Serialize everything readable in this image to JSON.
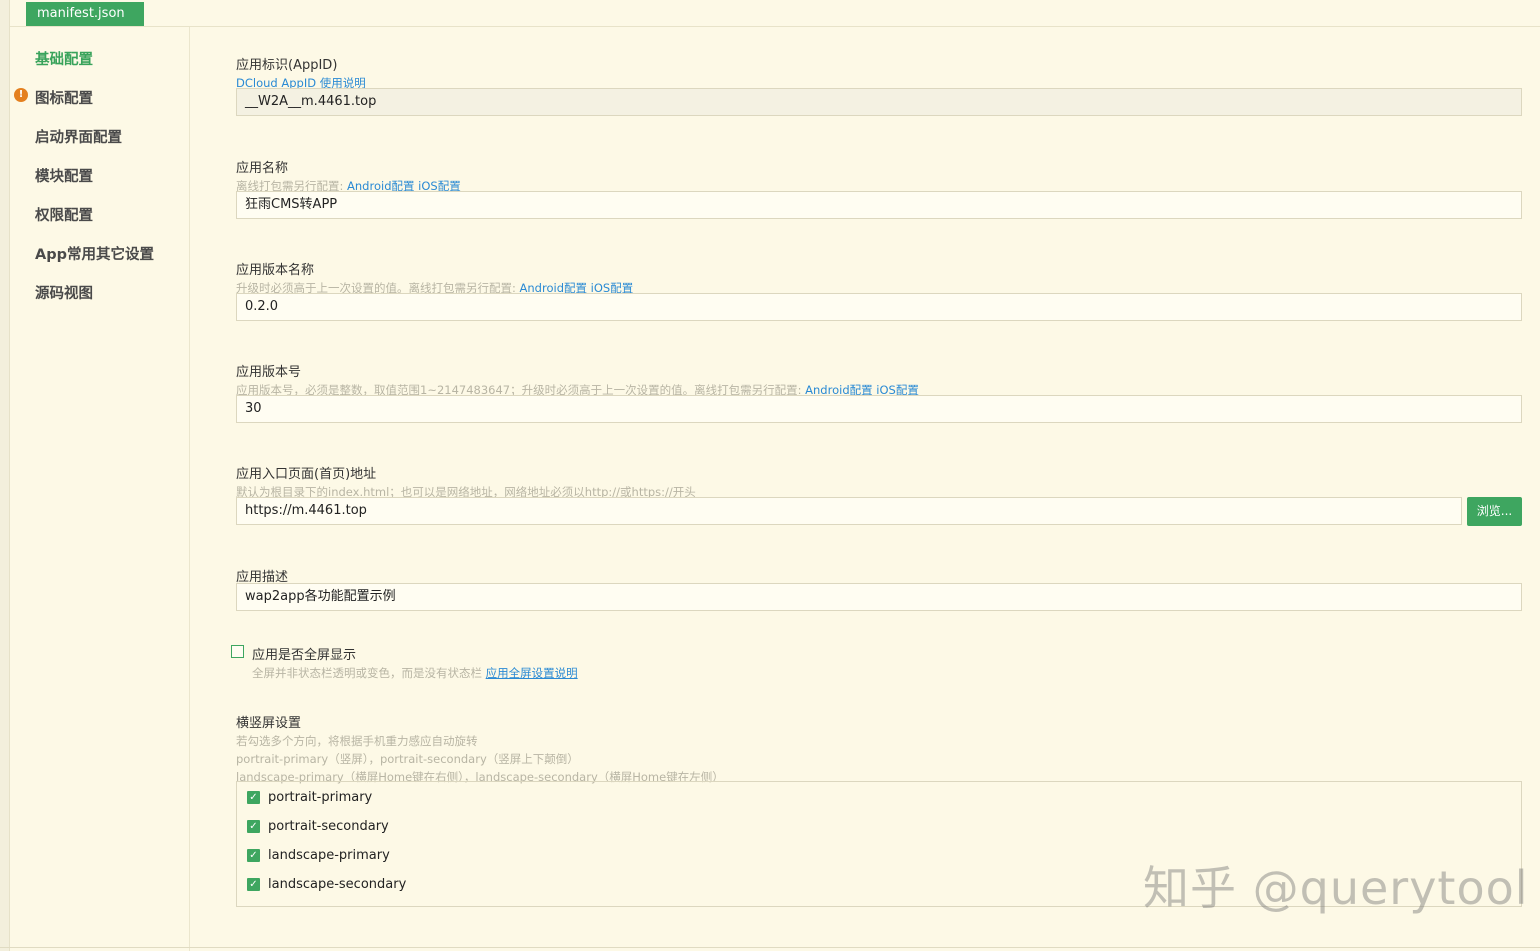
{
  "tab": {
    "label": "manifest.json"
  },
  "sidebar": {
    "items": [
      {
        "label": "基础配置"
      },
      {
        "label": "图标配置"
      },
      {
        "label": "启动界面配置"
      },
      {
        "label": "模块配置"
      },
      {
        "label": "权限配置"
      },
      {
        "label": "App常用其它设置"
      },
      {
        "label": "源码视图"
      }
    ]
  },
  "appid": {
    "label": "应用标识(AppID)",
    "link": "DCloud AppID 使用说明",
    "value": "__W2A__m.4461.top"
  },
  "name": {
    "label": "应用名称",
    "hint": "离线打包需另行配置:",
    "android": "Android配置",
    "ios": "iOS配置",
    "value": "狂雨CMS转APP"
  },
  "version_name": {
    "label": "应用版本名称",
    "hint": "升级时必须高于上一次设置的值。离线打包需另行配置:",
    "android": "Android配置",
    "ios": "iOS配置",
    "value": "0.2.0"
  },
  "version_code": {
    "label": "应用版本号",
    "hint": "应用版本号，必须是整数，取值范围1~2147483647；升级时必须高于上一次设置的值。离线打包需另行配置:",
    "android": "Android配置",
    "ios": "iOS配置",
    "value": "30"
  },
  "entry": {
    "label": "应用入口页面(首页)地址",
    "hint": "默认为根目录下的index.html；也可以是网络地址，网络地址必须以http://或https://开头",
    "value": "https://m.4461.top",
    "browse": "浏览..."
  },
  "desc": {
    "label": "应用描述",
    "value": "wap2app各功能配置示例"
  },
  "fullscreen": {
    "label": "应用是否全屏显示",
    "hint": "全屏并非状态栏透明或变色，而是没有状态栏",
    "link": "应用全屏设置说明"
  },
  "orientation": {
    "label": "横竖屏设置",
    "hint1": "若勾选多个方向，将根据手机重力感应自动旋转",
    "hint2": "portrait-primary（竖屏），portrait-secondary（竖屏上下颠倒）",
    "hint3": "landscape-primary（横屏Home键在右侧），landscape-secondary（横屏Home键在左侧）",
    "options": [
      {
        "label": "portrait-primary",
        "checked": true
      },
      {
        "label": "portrait-secondary",
        "checked": true
      },
      {
        "label": "landscape-primary",
        "checked": true
      },
      {
        "label": "landscape-secondary",
        "checked": true
      }
    ]
  },
  "watermark": "知乎 @querytool"
}
